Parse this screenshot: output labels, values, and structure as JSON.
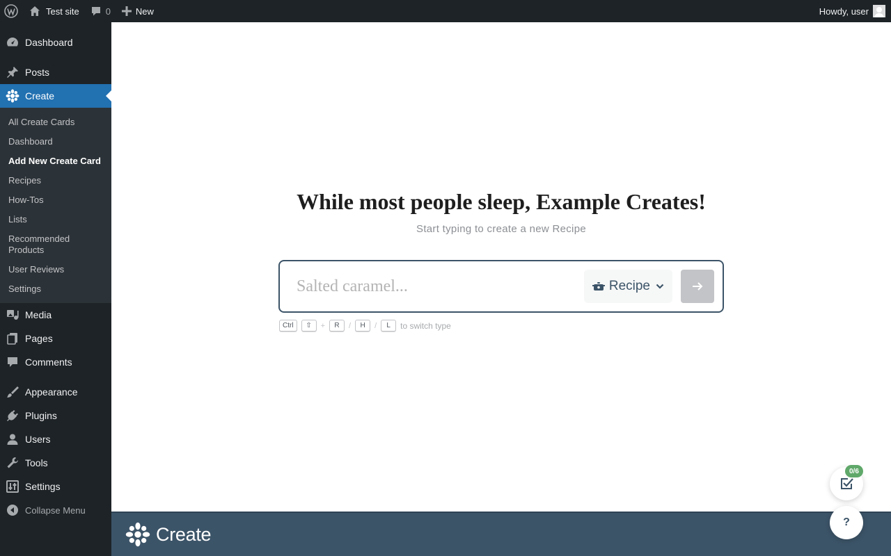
{
  "adminbar": {
    "site_name": "Test site",
    "comments_count": "0",
    "new_label": "New",
    "greeting": "Howdy, user"
  },
  "sidebar": {
    "items_top": [
      {
        "label": "Dashboard",
        "icon": "dashboard-icon"
      },
      {
        "label": "Posts",
        "icon": "pin-icon"
      },
      {
        "label": "Create",
        "icon": "flower-icon",
        "current": true
      }
    ],
    "submenu": [
      {
        "label": "All Create Cards"
      },
      {
        "label": "Dashboard"
      },
      {
        "label": "Add New Create Card",
        "current": true
      },
      {
        "label": "Recipes"
      },
      {
        "label": "How-Tos"
      },
      {
        "label": "Lists"
      },
      {
        "label": "Recommended Products"
      },
      {
        "label": "User Reviews"
      },
      {
        "label": "Settings"
      }
    ],
    "items_mid": [
      {
        "label": "Media"
      },
      {
        "label": "Pages"
      },
      {
        "label": "Comments"
      }
    ],
    "items_bottom": [
      {
        "label": "Appearance"
      },
      {
        "label": "Plugins"
      },
      {
        "label": "Users"
      },
      {
        "label": "Tools"
      },
      {
        "label": "Settings"
      }
    ],
    "collapse_label": "Collapse Menu"
  },
  "main": {
    "headline": "While most people sleep, Example Creates!",
    "subline": "Start typing to create a new Recipe",
    "input_placeholder": "Salted caramel...",
    "input_value": "",
    "type_selected": "Recipe",
    "hint": {
      "keys": [
        "Ctrl",
        "⇧",
        "+",
        "R",
        "/",
        "H",
        "/",
        "L"
      ],
      "text": "to switch type"
    }
  },
  "footer": {
    "brand": "Create"
  },
  "floating": {
    "checklist_badge": "0/6",
    "help_label": "?"
  },
  "colors": {
    "admin_dark": "#1d2327",
    "accent_blue": "#2271b1",
    "brand_slate": "#3c5468",
    "badge_green": "#5fa86a"
  }
}
